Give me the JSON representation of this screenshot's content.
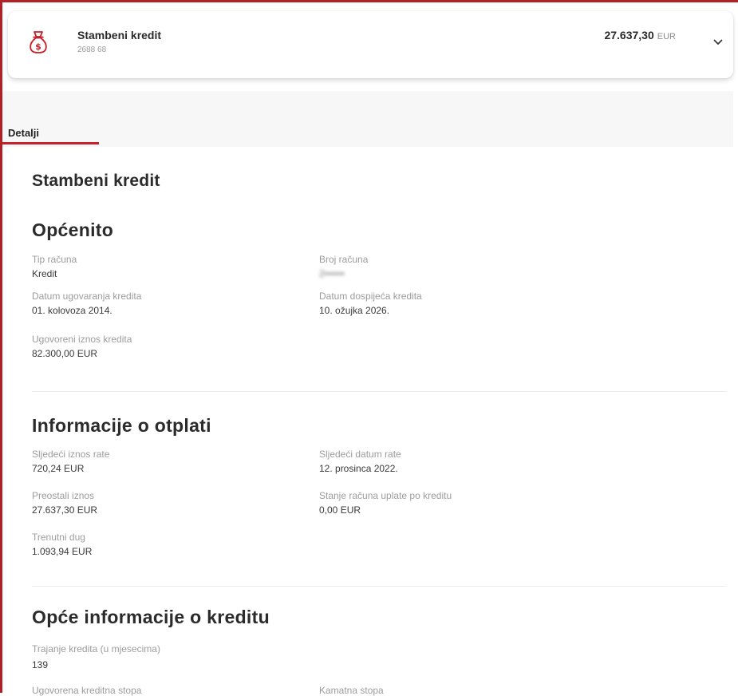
{
  "account": {
    "name": "Stambeni kredit",
    "number": "2688 68",
    "balance": "27.637,30",
    "currency": "EUR"
  },
  "tabs": {
    "details": "Detalji"
  },
  "page_title": "Stambeni kredit",
  "general": {
    "heading": "Općenito",
    "account_type_label": "Tip računa",
    "account_type_value": "Kredit",
    "account_number_label": "Broj računa",
    "account_number_value": "2••••••",
    "contract_date_label": "Datum ugovaranja kredita",
    "contract_date_value": "01. kolovoza 2014.",
    "maturity_date_label": "Datum dospijeća kredita",
    "maturity_date_value": "10. ožujka 2026.",
    "contracted_amount_label": "Ugovoreni iznos kredita",
    "contracted_amount_value": "82.300,00 EUR"
  },
  "repayment": {
    "heading": "Informacije o otplati",
    "next_installment_amount_label": "Sljedeći iznos rate",
    "next_installment_amount_value": "720,24 EUR",
    "next_installment_date_label": "Sljedeći datum rate",
    "next_installment_date_value": "12. prosinca 2022.",
    "remaining_amount_label": "Preostali iznos",
    "remaining_amount_value": "27.637,30 EUR",
    "payment_balance_label": "Stanje računa uplate po kreditu",
    "payment_balance_value": "0,00 EUR",
    "current_debt_label": "Trenutni dug",
    "current_debt_value": "1.093,94 EUR"
  },
  "loan_info": {
    "heading": "Opće informacije o kreditu",
    "duration_label": "Trajanje kredita (u mjesecima)",
    "duration_value": "139",
    "contracted_rate_label": "Ugovorena kreditna stopa",
    "interest_rate_label": "Kamatna stopa"
  },
  "colors": {
    "accent": "#c8202a",
    "frame": "#b32025"
  },
  "icons": {
    "account": "money-bag-icon",
    "expand": "chevron-down-icon"
  }
}
